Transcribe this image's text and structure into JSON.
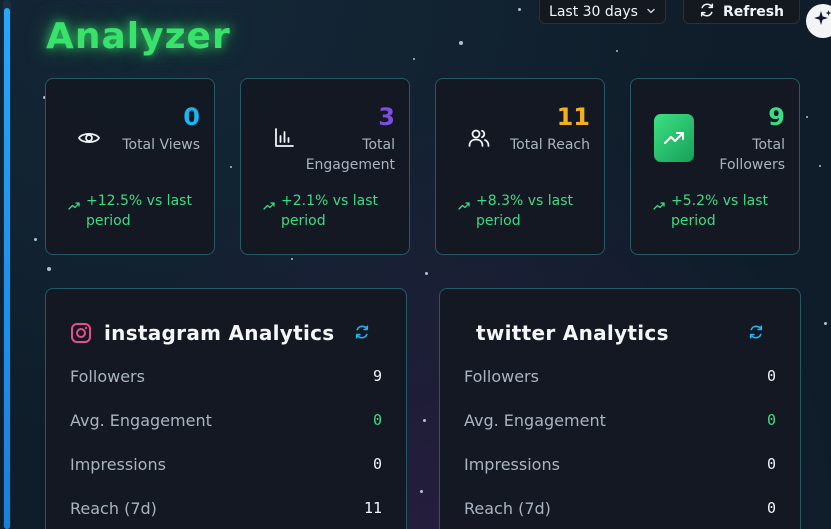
{
  "header": {
    "app_title": "Analyzer",
    "period_label": "Last 30 days",
    "refresh_label": "Refresh"
  },
  "stats": [
    {
      "value": "0",
      "label": "Total Views",
      "change": "+12.5% vs last period",
      "color": "#1eb4f0",
      "icon": "eye-icon"
    },
    {
      "value": "3",
      "label": "Total Engagement",
      "change": "+2.1% vs last period",
      "color": "#7c4fe0",
      "icon": "bar-chart-icon"
    },
    {
      "value": "11",
      "label": "Total Reach",
      "change": "+8.3% vs last period",
      "color": "#f5b020",
      "icon": "users-icon"
    },
    {
      "value": "9",
      "label": "Total Followers",
      "change": "+5.2% vs last period",
      "color": "#3ddc84",
      "icon": "trending-up-icon"
    }
  ],
  "panels": [
    {
      "title": "instagram Analytics",
      "icon": "instagram-icon",
      "rows": [
        {
          "label": "Followers",
          "value": "9"
        },
        {
          "label": "Avg. Engagement",
          "value": "0"
        },
        {
          "label": "Impressions",
          "value": "0"
        },
        {
          "label": "Reach (7d)",
          "value": "11"
        }
      ]
    },
    {
      "title": "twitter Analytics",
      "rows": [
        {
          "label": "Followers",
          "value": "0"
        },
        {
          "label": "Avg. Engagement",
          "value": "0"
        },
        {
          "label": "Impressions",
          "value": "0"
        },
        {
          "label": "Reach (7d)",
          "value": "0"
        }
      ]
    }
  ],
  "colors": {
    "accent_green": "#3ddc84",
    "card_border": "#245a63",
    "refresh_icon": "#1eb4f0"
  }
}
